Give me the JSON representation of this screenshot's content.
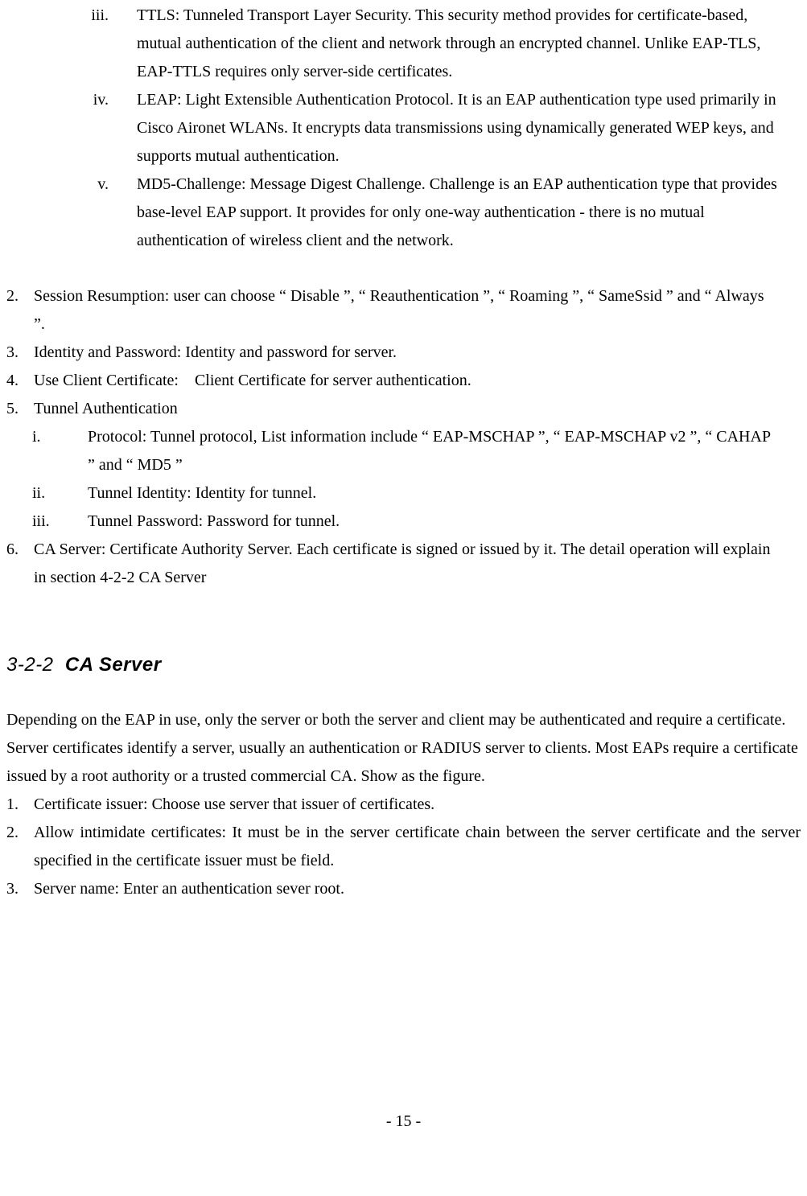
{
  "top_roman": [
    {
      "marker": "iii.",
      "text": "TTLS: Tunneled Transport Layer Security. This security method provides for certificate-based, mutual authentication of the client and network through an encrypted channel. Unlike EAP-TLS, EAP-TTLS requires only server-side certificates."
    },
    {
      "marker": "iv.",
      "text": "LEAP: Light Extensible Authentication Protocol. It is an EAP authentication type used primarily in Cisco Aironet WLANs. It encrypts data transmissions using dynamically generated WEP keys, and supports mutual authentication."
    },
    {
      "marker": "v.",
      "text": "MD5-Challenge: Message Digest Challenge. Challenge is an EAP authentication type that provides base-level EAP support. It provides for only one-way authentication - there is no mutual authentication of wireless client and the network."
    }
  ],
  "main_list": {
    "item2": {
      "marker": "2.",
      "text": "Session Resumption: user can choose “ Disable ”, “ Reauthentication ”, “ Roaming ”, “ SameSsid ” and “ Always ”."
    },
    "item3": {
      "marker": "3.",
      "text": "Identity and Password: Identity and password for server."
    },
    "item4": {
      "marker": "4.",
      "text": "Use Client Certificate: Client Certificate for server authentication."
    },
    "item5": {
      "marker": "5.",
      "text": "Tunnel Authentication"
    },
    "item5_sub": [
      {
        "marker": "i.",
        "text": "Protocol: Tunnel protocol, List information include “ EAP-MSCHAP ”, “ EAP-MSCHAP v2 ”, “ CAHAP ” and “ MD5 ”"
      },
      {
        "marker": "ii.",
        "text": "Tunnel Identity: Identity for tunnel."
      },
      {
        "marker": "iii.",
        "text": "Tunnel Password: Password for tunnel."
      }
    ],
    "item6": {
      "marker": "6.",
      "text": "CA Server: Certificate Authority Server. Each certificate is signed or issued by it. The detail operation will explain in section 4-2-2 CA Server"
    }
  },
  "section": {
    "number": "3-2-2",
    "title": "CA Server"
  },
  "section_para": "Depending on the EAP in use, only the server or both the server and client may be authenticated and require a certificate. Server certificates identify a server, usually an authentication or RADIUS server to clients. Most EAPs require a certificate issued by a root authority or a trusted commercial CA. Show as the figure.",
  "section_list": [
    {
      "marker": "1.",
      "text": "Certificate issuer: Choose use server that issuer of certificates."
    },
    {
      "marker": "2.",
      "text": "Allow intimidate certificates: It must be in the server certificate chain between the server certificate and the server specified in the certificate issuer must be field.",
      "justify": true
    },
    {
      "marker": "3.",
      "text": "Server name: Enter an authentication sever root."
    }
  ],
  "page_number": "- 15 -"
}
